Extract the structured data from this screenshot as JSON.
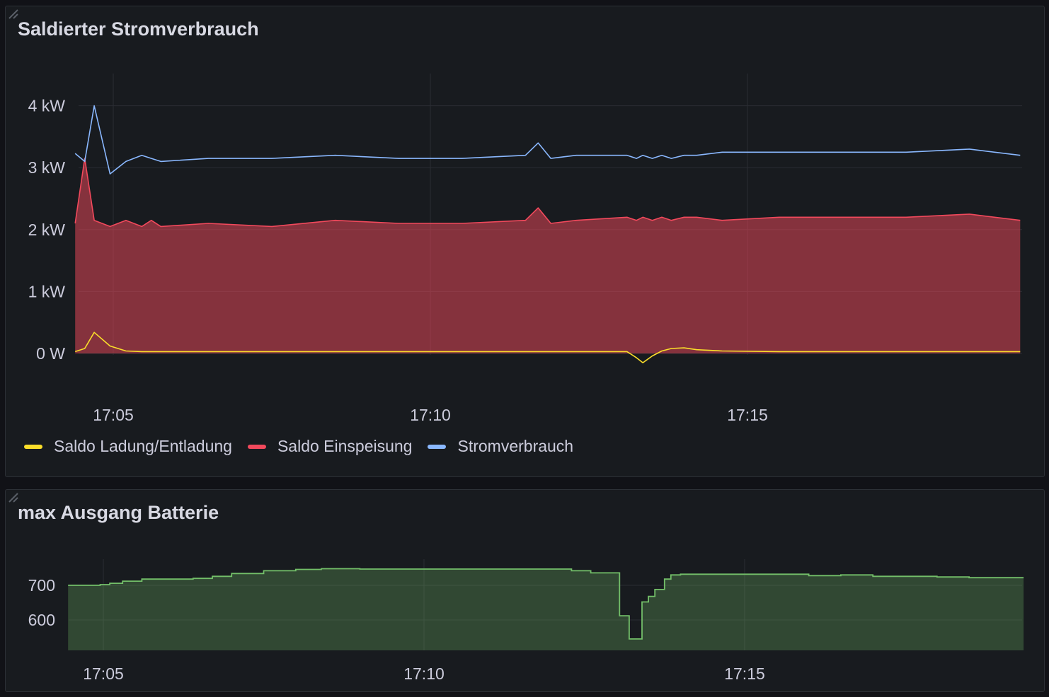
{
  "panels": [
    {
      "title": "Saldierter Stromverbrauch"
    },
    {
      "title": "max Ausgang Batterie"
    }
  ],
  "legend": [
    {
      "label": "Saldo Ladung/Entladung",
      "color": "#fade2a"
    },
    {
      "label": "Saldo Einspeisung",
      "color": "#f2495c"
    },
    {
      "label": "Stromverbrauch",
      "color": "#8ab8ff"
    }
  ],
  "chart_data": [
    {
      "type": "area",
      "title": "Saldierter Stromverbrauch",
      "x_ticks": [
        "17:05",
        "17:10",
        "17:15"
      ],
      "y_ticks": [
        "0 W",
        "1 kW",
        "2 kW",
        "3 kW",
        "4 kW"
      ],
      "x_range_min": [
        4.4,
        19.3
      ],
      "ylim": [
        0,
        4000
      ],
      "grid": true,
      "legend_position": "bottom-left",
      "x": [
        4.4,
        4.55,
        4.7,
        4.95,
        5.2,
        5.45,
        5.6,
        5.75,
        6.5,
        7.5,
        8.5,
        9.5,
        10.5,
        11.5,
        11.7,
        11.9,
        12.3,
        13.1,
        13.25,
        13.35,
        13.5,
        13.65,
        13.8,
        14.0,
        14.2,
        14.6,
        15.5,
        16.5,
        17.5,
        18.5,
        19.3
      ],
      "series": [
        {
          "name": "Saldo Ladung/Entladung",
          "color": "#fade2a",
          "values": [
            30,
            80,
            340,
            120,
            40,
            30,
            30,
            30,
            30,
            30,
            30,
            30,
            30,
            30,
            30,
            30,
            30,
            30,
            -70,
            -150,
            -40,
            40,
            80,
            90,
            60,
            40,
            30,
            30,
            30,
            30,
            30
          ]
        },
        {
          "name": "Saldo Einspeisung",
          "color": "#f2495c",
          "values": [
            2100,
            3150,
            2150,
            2050,
            2150,
            2050,
            2150,
            2050,
            2100,
            2050,
            2150,
            2100,
            2100,
            2150,
            2350,
            2100,
            2150,
            2200,
            2150,
            2200,
            2150,
            2200,
            2150,
            2200,
            2200,
            2150,
            2200,
            2200,
            2200,
            2250,
            2150
          ]
        },
        {
          "name": "Stromverbrauch",
          "color": "#8ab8ff",
          "values": [
            3230,
            3100,
            4000,
            2900,
            3100,
            3200,
            3150,
            3100,
            3150,
            3150,
            3200,
            3150,
            3150,
            3200,
            3400,
            3150,
            3200,
            3200,
            3150,
            3200,
            3150,
            3200,
            3150,
            3200,
            3200,
            3250,
            3250,
            3250,
            3250,
            3300,
            3200
          ]
        }
      ]
    },
    {
      "type": "area",
      "title": "max Ausgang Batterie",
      "x_ticks": [
        "17:05",
        "17:10",
        "17:15"
      ],
      "y_ticks": [
        "600",
        "700"
      ],
      "ylim": [
        540,
        760
      ],
      "grid": true,
      "step": true,
      "color": "#73bf69",
      "x": [
        4.45,
        4.95,
        5.1,
        5.3,
        5.6,
        6.4,
        6.7,
        7.0,
        7.5,
        8.0,
        8.4,
        9.0,
        12.3,
        12.6,
        13.05,
        13.2,
        13.4,
        13.5,
        13.6,
        13.75,
        13.85,
        14.0,
        15.0,
        16.0,
        16.5,
        17.0,
        18.0,
        18.5,
        19.35
      ],
      "values": [
        700,
        702,
        706,
        712,
        718,
        720,
        726,
        734,
        742,
        746,
        748,
        747,
        742,
        736,
        612,
        545,
        652,
        668,
        688,
        718,
        730,
        732,
        732,
        728,
        730,
        726,
        724,
        722,
        722
      ]
    }
  ]
}
